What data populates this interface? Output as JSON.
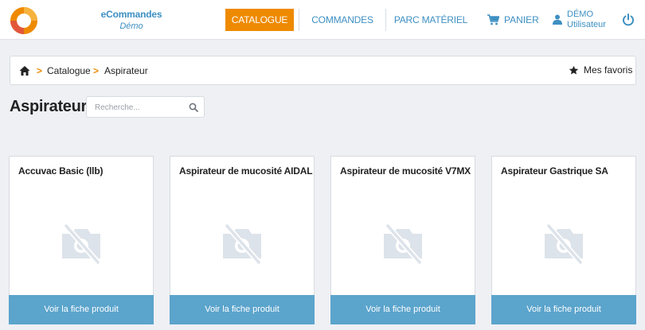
{
  "brand": {
    "name": "eCommandes",
    "subtitle": "Démo",
    "logo_icon": "ring-logo-icon",
    "colors": {
      "accent": "#ee8a00",
      "primary": "#3d8fc2",
      "button": "#5ba4cc"
    }
  },
  "nav": {
    "catalogue": "CATALOGUE",
    "commandes": "COMMANDES",
    "parc": "PARC MATÉRIEL",
    "panier": "PANIER",
    "user_name": "DÉMO",
    "user_role": "Utilisateur"
  },
  "breadcrumb": {
    "items": [
      "Catalogue",
      "Aspirateur"
    ],
    "separator": ">",
    "favorites": "Mes favoris"
  },
  "page": {
    "title": "Aspirateur",
    "search_placeholder": "Recherche..."
  },
  "products": [
    {
      "title": "Accuvac Basic (llb)",
      "button": "Voir la fiche produit"
    },
    {
      "title": "Aspirateur de mucosité AIDAL",
      "button": "Voir la fiche produit"
    },
    {
      "title": "Aspirateur de mucosité V7MX",
      "button": "Voir la fiche produit"
    },
    {
      "title": "Aspirateur Gastrique SA",
      "button": "Voir la fiche produit"
    }
  ]
}
